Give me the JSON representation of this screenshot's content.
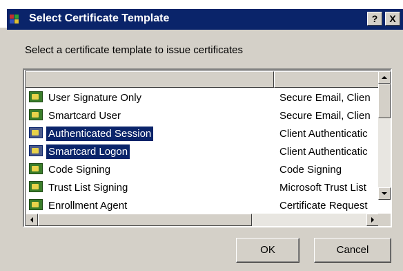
{
  "dialog": {
    "title": "Select Certificate Template",
    "help_label": "?",
    "close_label": "X",
    "prompt": "Select a certificate template to issue certificates"
  },
  "list": {
    "columns": [
      "",
      ""
    ],
    "rows": [
      {
        "name": "User Signature Only",
        "purpose": "Secure Email, Clien",
        "selected": false
      },
      {
        "name": "Smartcard User",
        "purpose": "Secure Email, Clien",
        "selected": false
      },
      {
        "name": "Authenticated Session",
        "purpose": "Client Authenticatic",
        "selected": true
      },
      {
        "name": "Smartcard Logon",
        "purpose": "Client Authenticatic",
        "selected": true
      },
      {
        "name": "Code Signing",
        "purpose": "Code Signing",
        "selected": false
      },
      {
        "name": "Trust List Signing",
        "purpose": "Microsoft Trust List",
        "selected": false
      },
      {
        "name": "Enrollment Agent",
        "purpose": "Certificate Request",
        "selected": false
      }
    ]
  },
  "buttons": {
    "ok": "OK",
    "cancel": "Cancel"
  },
  "icons": {
    "title": "certificate-template-icon",
    "row": "certificate-icon"
  },
  "colors": {
    "titlebar": "#0a246a",
    "selection": "#0a246a",
    "face": "#d4d0c8"
  }
}
